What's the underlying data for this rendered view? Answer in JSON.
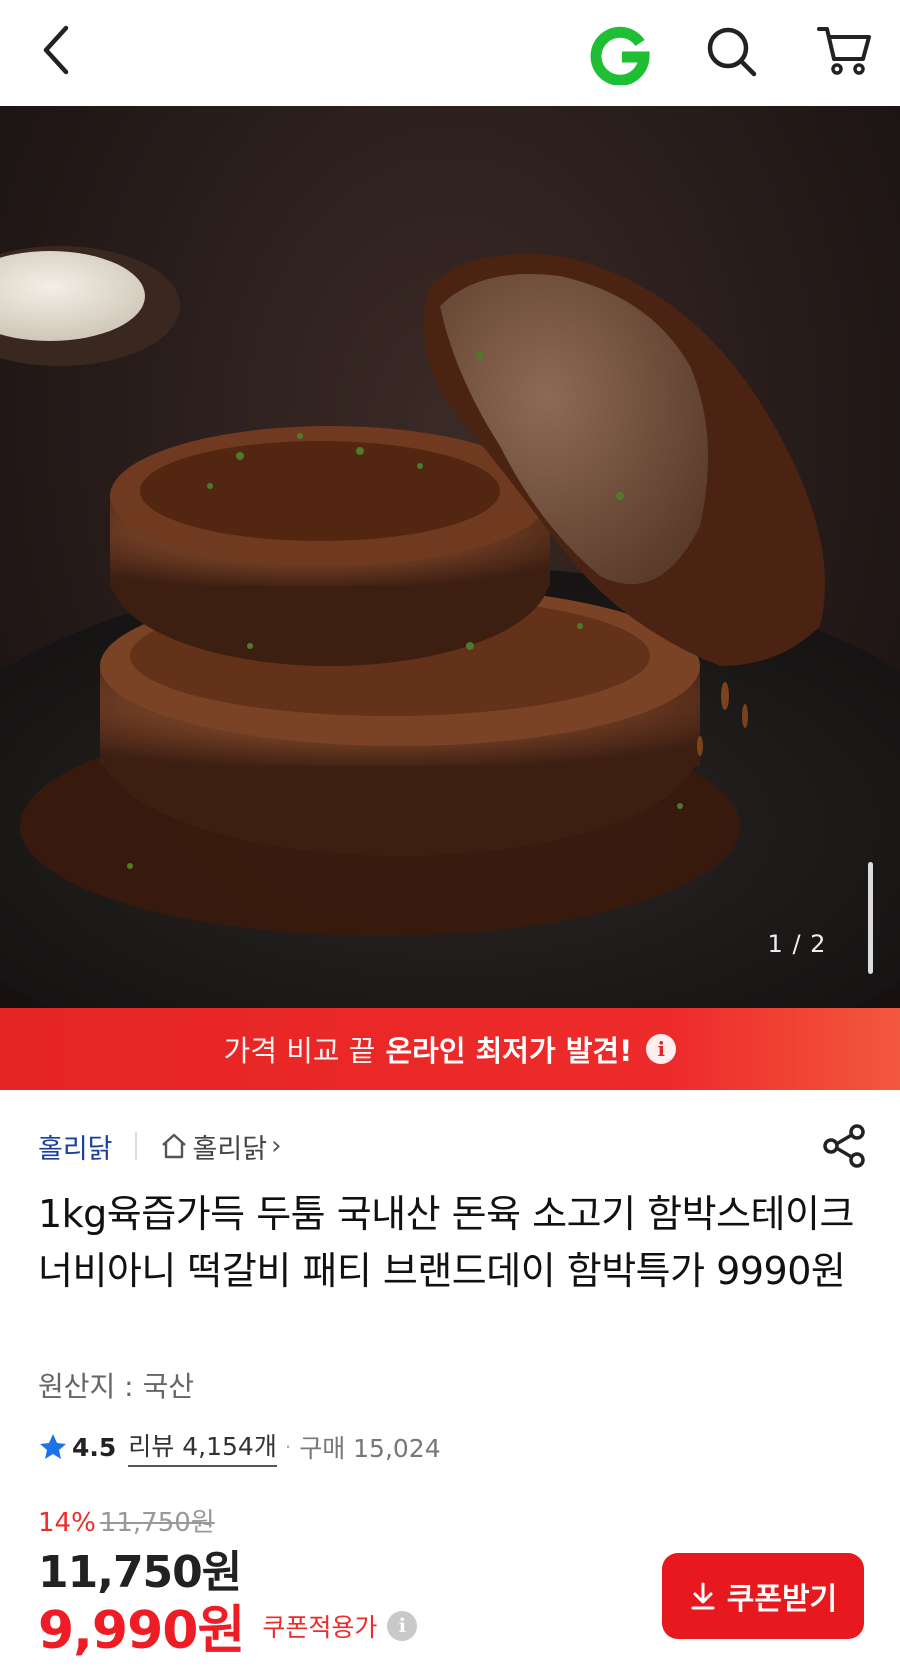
{
  "header": {
    "back_icon": "chevron-left-icon",
    "logo": "G",
    "logo_color": "#1fbf35",
    "search_icon": "search-icon",
    "cart_icon": "cart-icon"
  },
  "gallery": {
    "counter": "1 / 2",
    "current": 1,
    "total": 2
  },
  "banner": {
    "text_normal": "가격 비교 끝",
    "text_bold": "온라인 최저가 발견!",
    "info_icon": "i",
    "color": "#e52424"
  },
  "seller": {
    "name": "홀리닭",
    "store_label": "홀리닭",
    "chevron": "›"
  },
  "product": {
    "title": "1kg육즙가득 두툼 국내산 돈육 소고기 함박스테이크 너비아니 떡갈비 패티 브랜드데이 함박특가 9990원",
    "origin": "원산지 : 국산"
  },
  "rating": {
    "score": "4.5",
    "reviews": "리뷰 4,154개",
    "dot": "·",
    "sold": "구매 15,024",
    "star_color": "#1a73e8"
  },
  "price": {
    "discount": "14%",
    "original": "11,750원",
    "sale": "11,750원",
    "coupon_price": "9,990원",
    "coupon_label": "쿠폰적용가",
    "info_icon": "i",
    "accent": "#ee1c25"
  },
  "coupon_button": {
    "label": "쿠폰받기",
    "icon": "download-icon"
  }
}
